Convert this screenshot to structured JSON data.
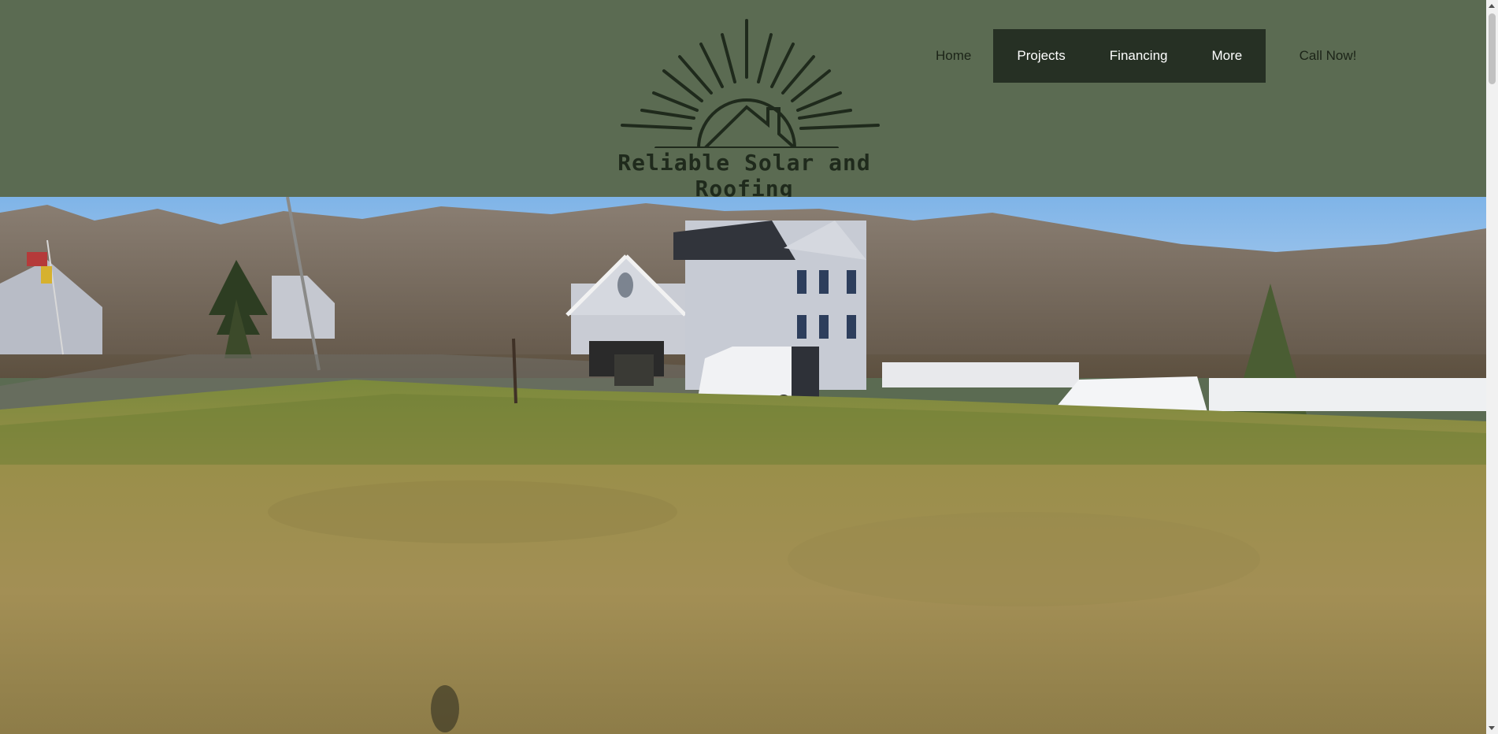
{
  "brand": {
    "name": "Reliable Solar and Roofing",
    "logo_icon": "sun-with-house-roof-icon"
  },
  "nav": {
    "items": [
      {
        "label": "Home"
      },
      {
        "label": "Projects"
      },
      {
        "label": "Financing"
      },
      {
        "label": "More"
      }
    ],
    "call_label": "Call Now!"
  },
  "hero": {
    "image": "aerial-photo-house-with-service-vans-on-lawn"
  },
  "colors": {
    "header_bg": "#5b6b52",
    "nav_active_bg": "#263024",
    "logo_dark": "#1f2a1c"
  }
}
